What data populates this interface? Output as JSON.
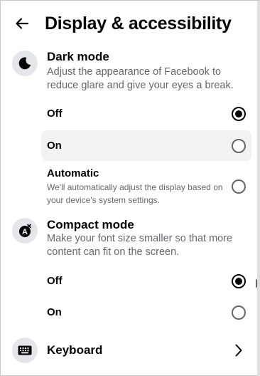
{
  "header": {
    "title": "Display & accessibility",
    "back_icon": "arrow-left-icon"
  },
  "dark_mode": {
    "title": "Dark mode",
    "description": "Adjust the appearance of Facebook to reduce glare and give your eyes a break.",
    "icon": "moon-icon",
    "options": [
      {
        "label": "Off",
        "selected": true
      },
      {
        "label": "On",
        "selected": false,
        "highlighted": true
      },
      {
        "label": "Automatic",
        "description": "We'll automatically adjust the display based on your device's system settings.",
        "selected": false
      }
    ]
  },
  "compact_mode": {
    "title": "Compact mode",
    "description": "Make your font size smaller so that more content can fit on the screen.",
    "icon": "compact-text-icon",
    "options": [
      {
        "label": "Off",
        "selected": true
      },
      {
        "label": "On",
        "selected": false
      }
    ]
  },
  "keyboard": {
    "label": "Keyboard",
    "icon": "keyboard-icon",
    "chevron_icon": "chevron-right-icon"
  },
  "colors": {
    "text_primary": "#050505",
    "text_secondary": "#65676b",
    "icon_bg": "#e4e6eb",
    "hover_bg": "#f2f2f2"
  }
}
